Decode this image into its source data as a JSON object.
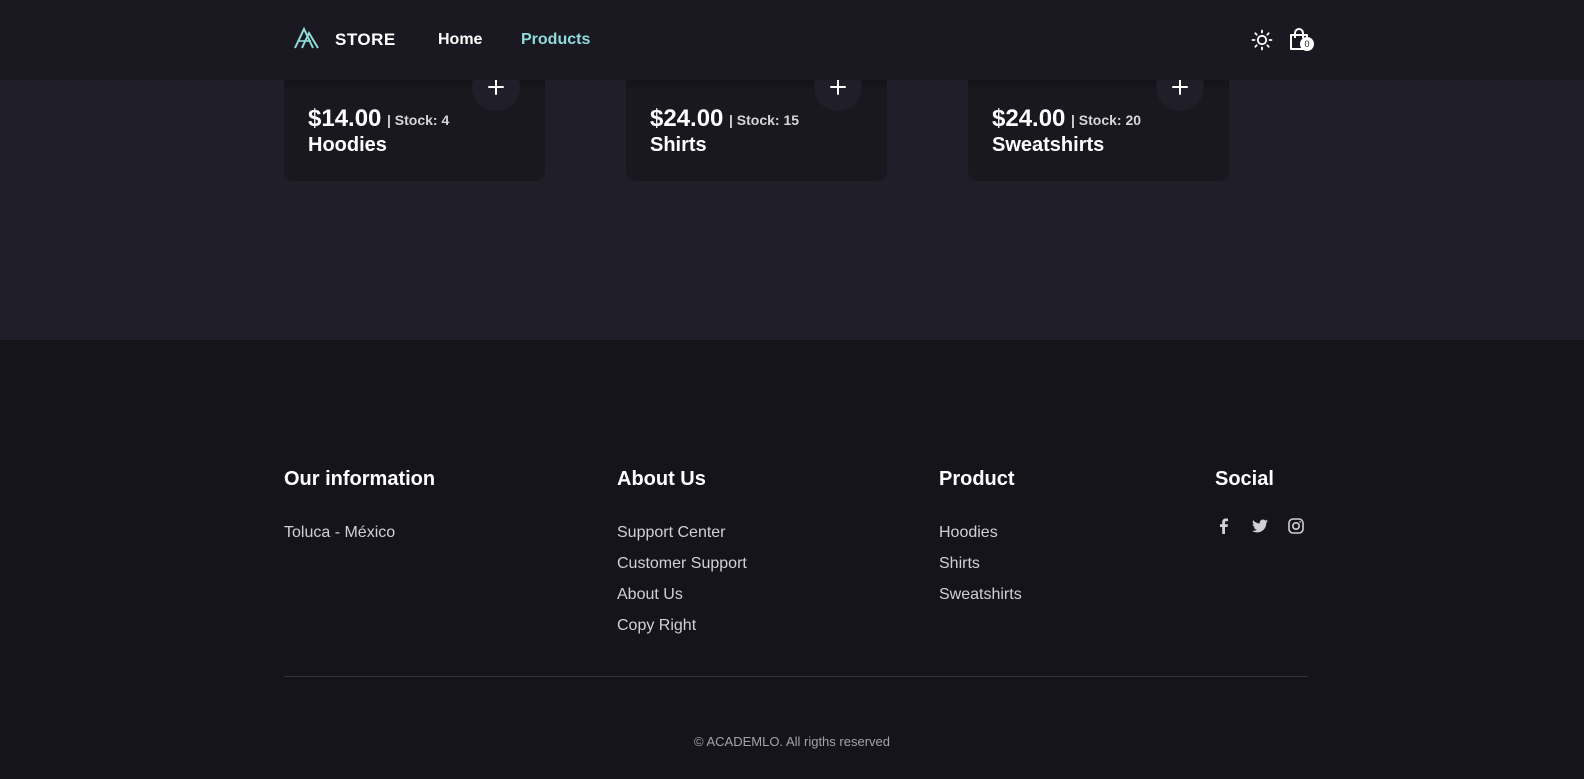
{
  "header": {
    "brand": "STORE",
    "nav": {
      "home": "Home",
      "products": "Products"
    },
    "cart_count": "0",
    "colors": {
      "accent": "#8fdbd9",
      "background": "#1a1921"
    },
    "icons": {
      "logo": "academlo-logo",
      "theme": "sun-icon",
      "cart": "shopping-bag-icon"
    }
  },
  "products": [
    {
      "price": "$14.00",
      "stock": "| Stock: 4",
      "name": "Hoodies"
    },
    {
      "price": "$24.00",
      "stock": "| Stock: 15",
      "name": "Shirts"
    },
    {
      "price": "$24.00",
      "stock": "| Stock: 20",
      "name": "Sweatshirts"
    }
  ],
  "footer": {
    "info": {
      "title": "Our information",
      "items": [
        "Toluca - México"
      ]
    },
    "about": {
      "title": "About Us",
      "items": [
        "Support Center",
        "Customer Support",
        "About Us",
        "Copy Right"
      ]
    },
    "product": {
      "title": "Product",
      "items": [
        "Hoodies",
        "Shirts",
        "Sweatshirts"
      ]
    },
    "social": {
      "title": "Social",
      "icons": [
        "facebook-icon",
        "twitter-icon",
        "instagram-icon"
      ]
    },
    "copyright": "© ACADEMLO. All rigths reserved"
  }
}
